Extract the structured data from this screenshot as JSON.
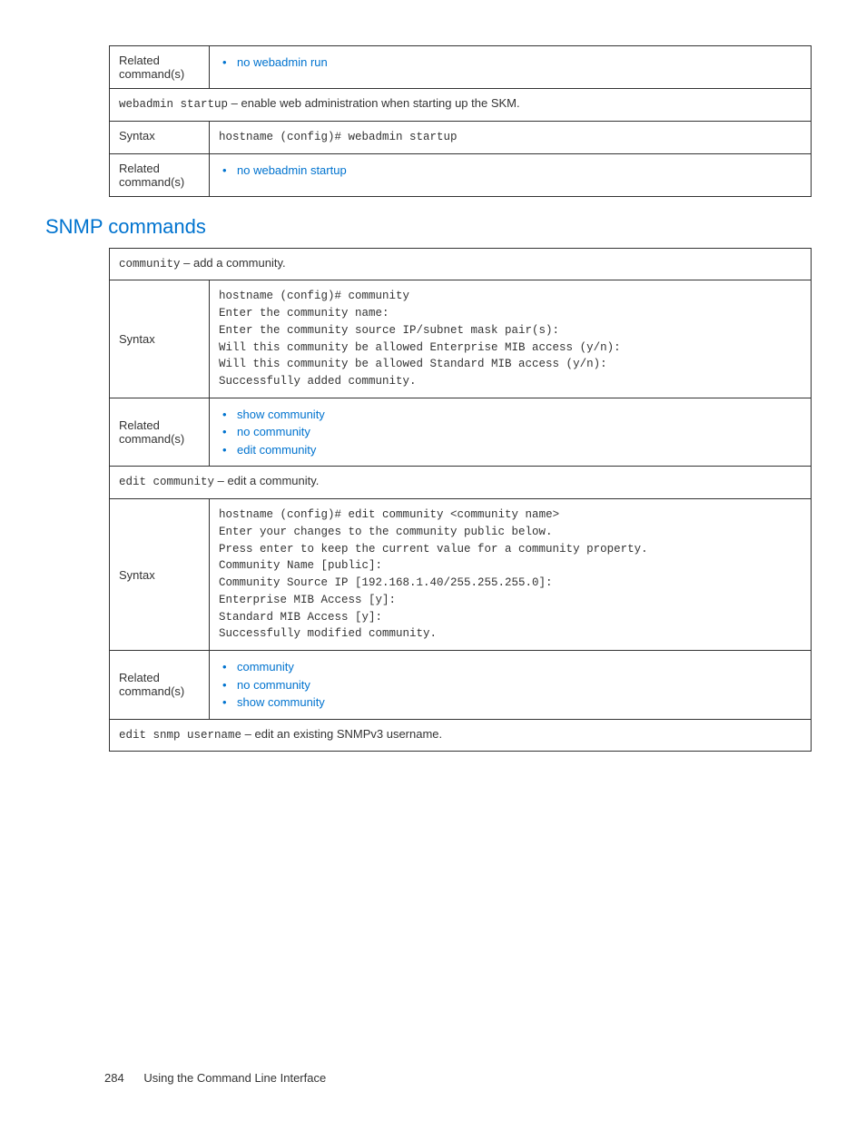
{
  "page": {
    "number": "284",
    "footer_text": "Using the Command Line Interface"
  },
  "section_heading": "SNMP commands",
  "table1": {
    "row_related_label": "Related command(s)",
    "row_related_items": [
      "no webadmin run"
    ],
    "row_webadmin_startup_cmd": "webadmin startup",
    "row_webadmin_startup_desc": " – enable web administration when starting up the SKM.",
    "row_syntax_label": "Syntax",
    "row_syntax_value": "hostname (config)# webadmin startup",
    "row_related2_label": "Related command(s)",
    "row_related2_items": [
      "no webadmin startup"
    ]
  },
  "table2": {
    "row_community_cmd": "community",
    "row_community_desc": " – add a community.",
    "row_syntax1_label": "Syntax",
    "row_syntax1_lines": [
      "hostname (config)# community",
      "Enter the community name:",
      "Enter the community source IP/subnet mask pair(s):",
      "Will this community be allowed Enterprise MIB access (y/n):",
      "Will this community be allowed Standard MIB access (y/n):",
      "Successfully added community."
    ],
    "row_related1_label": "Related command(s)",
    "row_related1_items": [
      "show community",
      "no community",
      "edit community"
    ],
    "row_edit_community_cmd": "edit community",
    "row_edit_community_desc": " – edit a community.",
    "row_syntax2_label": "Syntax",
    "row_syntax2_line1_prefix": "hostname (config)# edit community ",
    "row_syntax2_line1_arg": "<community name>",
    "row_syntax2_lines": [
      "Enter your changes to the community public below.",
      "Press enter to keep the current value for a community property.",
      "Community Name [public]:",
      "Community Source IP [192.168.1.40/255.255.255.0]:",
      "Enterprise MIB Access [y]:",
      "Standard MIB Access [y]:",
      "Successfully modified community."
    ],
    "row_related2_label": "Related command(s)",
    "row_related2_items": [
      "community",
      "no community",
      "show community"
    ],
    "row_edit_snmp_cmd": "edit snmp username",
    "row_edit_snmp_desc": " – edit an existing SNMPv3 username."
  }
}
